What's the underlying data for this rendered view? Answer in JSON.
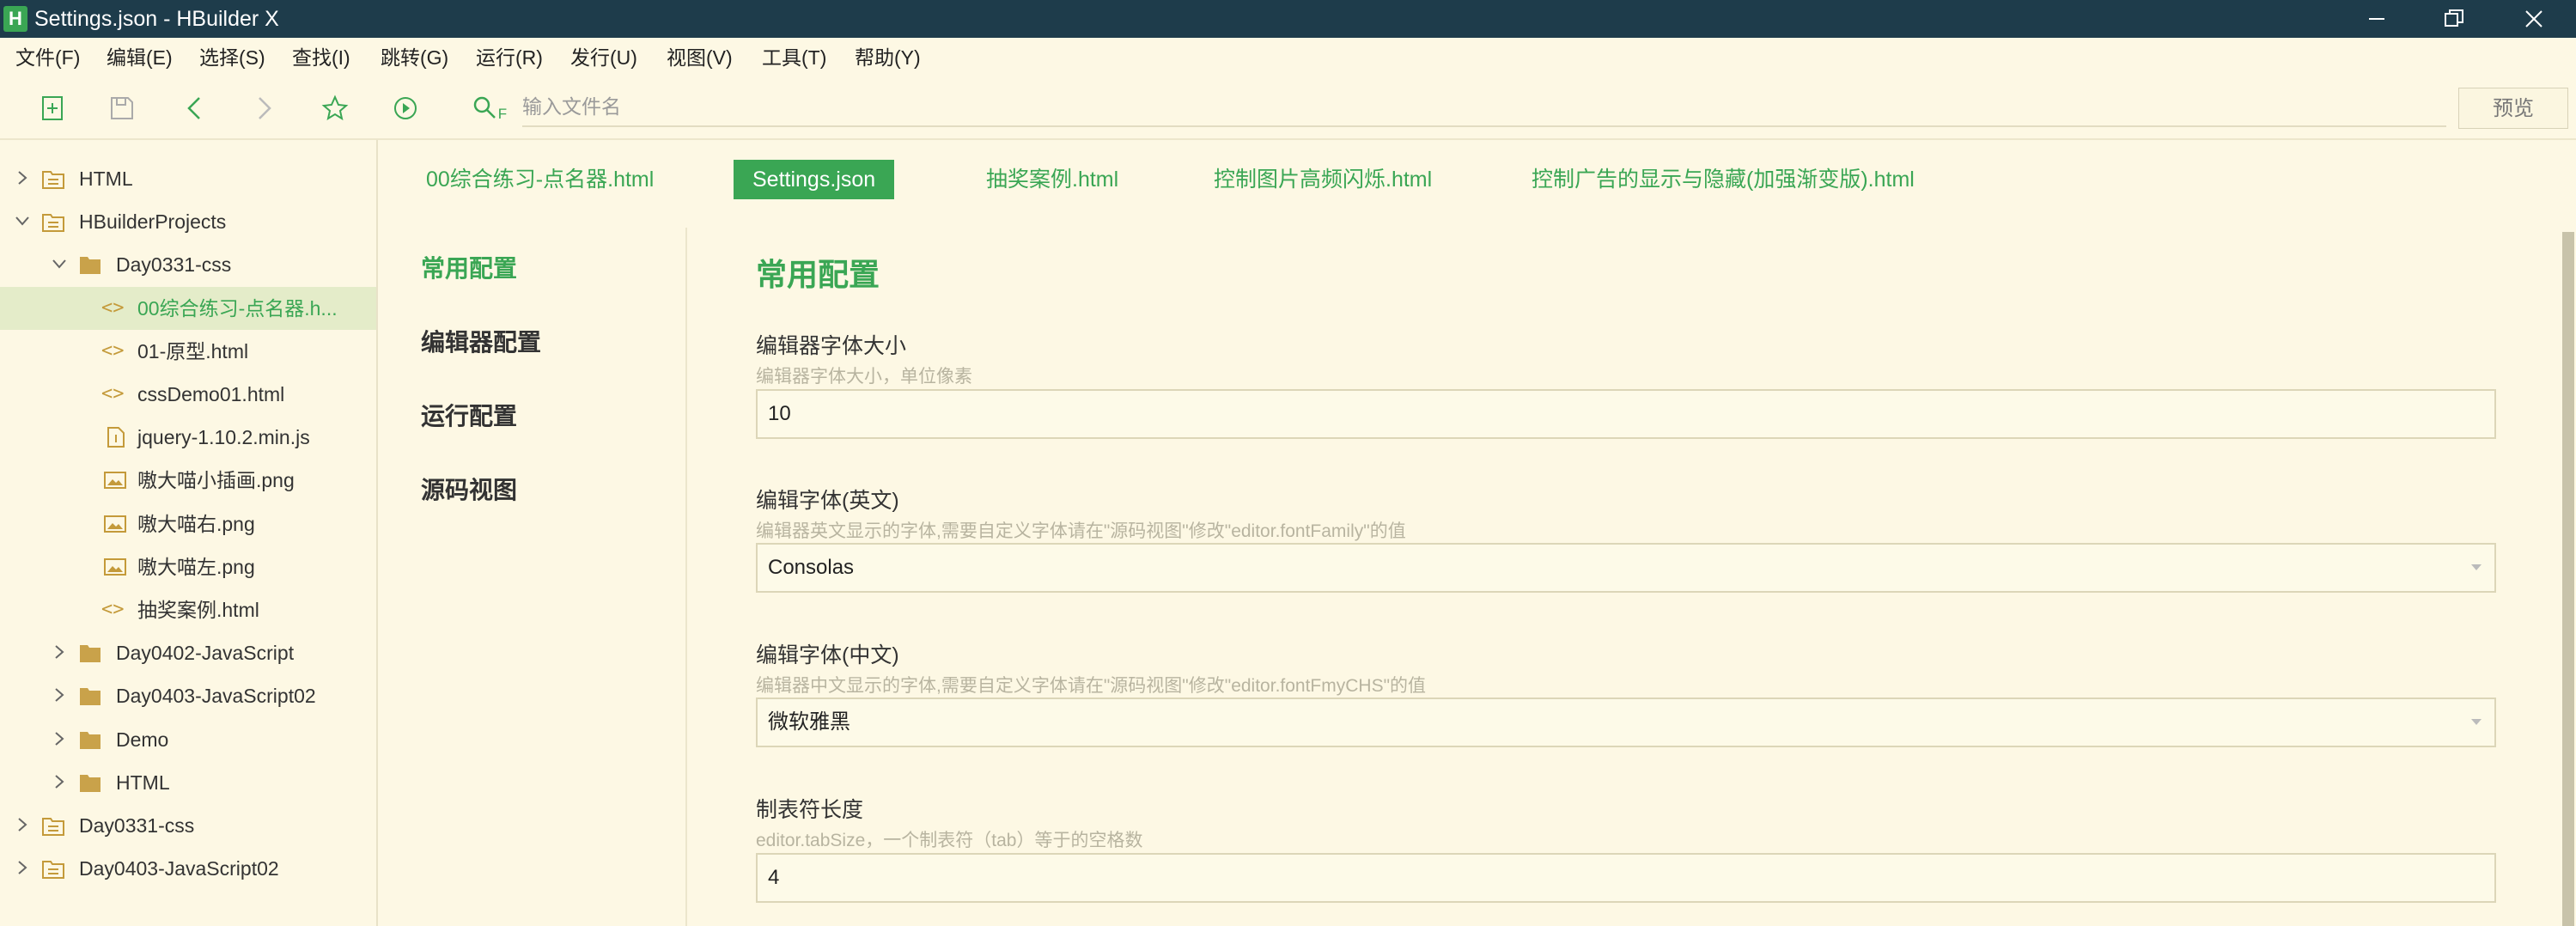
{
  "window": {
    "logo_text": "H",
    "title": "Settings.json - HBuilder X",
    "controls": [
      "minimize-icon",
      "restore-icon",
      "close-icon"
    ]
  },
  "menubar": {
    "items": [
      "文件(F)",
      "编辑(E)",
      "选择(S)",
      "查找(I)",
      "跳转(G)",
      "运行(R)",
      "发行(U)",
      "视图(V)",
      "工具(T)",
      "帮助(Y)"
    ]
  },
  "toolbar": {
    "icons": [
      "new-file-icon",
      "save-icon",
      "back-icon",
      "forward-icon",
      "favorite-star-icon",
      "run-icon",
      "search-file-icon"
    ],
    "search_icon_suffix": "F",
    "search_placeholder": "输入文件名",
    "preview_label": "预览"
  },
  "sidebar": {
    "tree": [
      {
        "label": "HTML",
        "type": "project",
        "expanded": false
      },
      {
        "label": "HBuilderProjects",
        "type": "project",
        "expanded": true
      },
      {
        "label": "Day0331-css",
        "type": "folder",
        "expanded": true
      },
      {
        "label": "00综合练习-点名器.h...",
        "type": "html",
        "selected": true
      },
      {
        "label": "01-原型.html",
        "type": "html"
      },
      {
        "label": "cssDemo01.html",
        "type": "html"
      },
      {
        "label": "jquery-1.10.2.min.js",
        "type": "js"
      },
      {
        "label": "嗷大喵小插画.png",
        "type": "image"
      },
      {
        "label": "嗷大喵右.png",
        "type": "image"
      },
      {
        "label": "嗷大喵左.png",
        "type": "image"
      },
      {
        "label": "抽奖案例.html",
        "type": "html"
      },
      {
        "label": "Day0402-JavaScript",
        "type": "folder",
        "expanded": false
      },
      {
        "label": "Day0403-JavaScript02",
        "type": "folder",
        "expanded": false
      },
      {
        "label": "Demo",
        "type": "folder",
        "expanded": false
      },
      {
        "label": "HTML",
        "type": "folder",
        "expanded": false
      },
      {
        "label": "Day0331-css",
        "type": "project",
        "expanded": false
      },
      {
        "label": "Day0403-JavaScript02",
        "type": "project",
        "expanded": false
      }
    ]
  },
  "tabs": [
    {
      "label": "00综合练习-点名器.html",
      "active": false
    },
    {
      "label": "Settings.json",
      "active": true
    },
    {
      "label": "抽奖案例.html",
      "active": false
    },
    {
      "label": "控制图片高频闪烁.html",
      "active": false
    },
    {
      "label": "控制广告的显示与隐藏(加强渐变版).html",
      "active": false
    }
  ],
  "settings_nav": {
    "items": [
      "常用配置",
      "编辑器配置",
      "运行配置",
      "源码视图"
    ],
    "active_index": 0
  },
  "settings": {
    "section_title": "常用配置",
    "fields": [
      {
        "label": "编辑器字体大小",
        "desc": "编辑器字体大小，单位像素",
        "value": "10",
        "kind": "input"
      },
      {
        "label": "编辑字体(英文)",
        "desc": "编辑器英文显示的字体,需要自定义字体请在\"源码视图\"修改\"editor.fontFamily\"的值",
        "value": "Consolas",
        "kind": "select"
      },
      {
        "label": "编辑字体(中文)",
        "desc": "编辑器中文显示的字体,需要自定义字体请在\"源码视图\"修改\"editor.fontFmyCHS\"的值",
        "value": "微软雅黑",
        "kind": "select"
      },
      {
        "label": "制表符长度",
        "desc": "editor.tabSize，一个制表符（tab）等于的空格数",
        "value": "4",
        "kind": "input"
      }
    ]
  },
  "colors": {
    "accent": "#3aa654",
    "titlebar": "#1e3c4b",
    "background": "#fdf8e4",
    "selected_row": "#e4ecc9"
  }
}
